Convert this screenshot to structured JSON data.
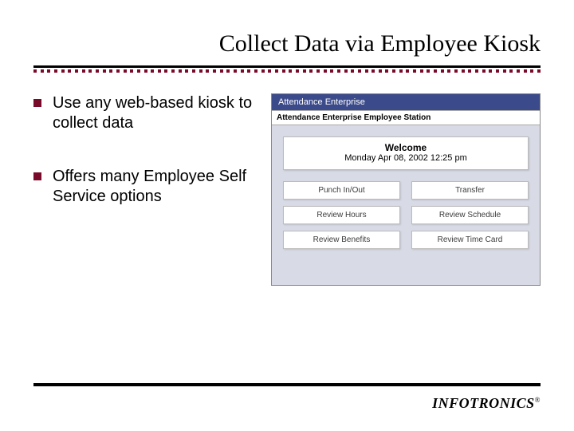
{
  "title": "Collect Data via Employee Kiosk",
  "bullets": [
    "Use any web-based kiosk to collect data",
    "Offers many Employee Self Service options"
  ],
  "kiosk": {
    "topbar": "Attendance Enterprise",
    "subbar": "Attendance Enterprise Employee Station",
    "welcome_title": "Welcome",
    "welcome_date": "Monday Apr 08, 2002 12:25 pm",
    "buttons": [
      "Punch In/Out",
      "Transfer",
      "Review Hours",
      "Review Schedule",
      "Review Benefits",
      "Review Time Card"
    ]
  },
  "brand": "INFOTRONICS",
  "brand_mark": "®"
}
